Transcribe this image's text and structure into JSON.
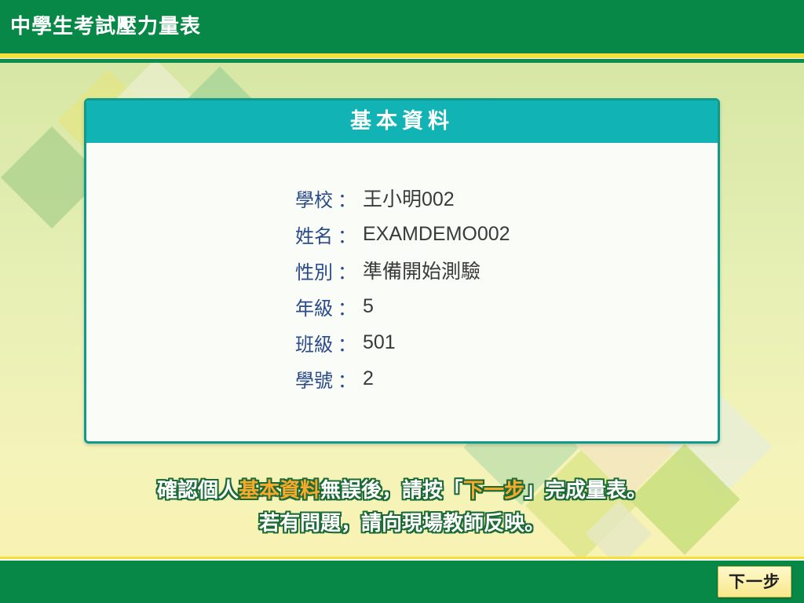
{
  "app": {
    "title": "中學生考試壓力量表"
  },
  "panel": {
    "title": "基本資料"
  },
  "info": [
    {
      "label": "學校",
      "value": "王小明002"
    },
    {
      "label": "姓名",
      "value": "EXAMDEMO002"
    },
    {
      "label": "性別",
      "value": "準備開始測驗"
    },
    {
      "label": "年級",
      "value": "5"
    },
    {
      "label": "班級",
      "value": "501"
    },
    {
      "label": "學號",
      "value": "2"
    }
  ],
  "separator": "：",
  "instructions": {
    "line1_before": "確認個人",
    "line1_highlight": "基本資料",
    "line1_middle": "無誤後，請按「",
    "line1_highlight2": "下一步",
    "line1_after": "」完成量表。",
    "line2": "若有問題，請向現場教師反映。"
  },
  "buttons": {
    "next": "下一步"
  },
  "colors": {
    "header_green": "#078846",
    "panel_header_teal": "#12b3b4",
    "label_blue": "#2a4a8a",
    "highlight_orange": "#f6a92a"
  }
}
